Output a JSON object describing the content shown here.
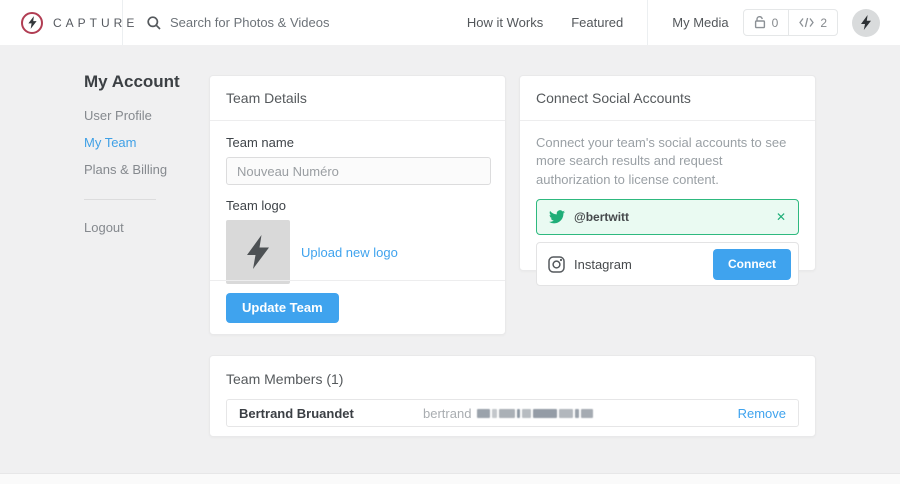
{
  "navbar": {
    "brand": "CAPTURE",
    "search_placeholder": "Search for Photos & Videos",
    "links": [
      {
        "label": "How it Works"
      },
      {
        "label": "Featured"
      }
    ],
    "my_media_label": "My Media",
    "locked_count": "0",
    "embed_count": "2"
  },
  "sidebar": {
    "title": "My Account",
    "items": [
      {
        "label": "User Profile"
      },
      {
        "label": "My Team"
      },
      {
        "label": "Plans & Billing"
      }
    ],
    "logout_label": "Logout"
  },
  "team_details": {
    "title": "Team Details",
    "team_name_label": "Team name",
    "team_name_value": "Nouveau Numéro",
    "team_logo_label": "Team logo",
    "upload_link_label": "Upload new logo",
    "update_button_label": "Update Team"
  },
  "social": {
    "title": "Connect Social Accounts",
    "description": "Connect your team's social accounts to see more search results and request authorization to license content.",
    "twitter": {
      "handle": "@bertwitt",
      "remove_glyph": "✕"
    },
    "instagram": {
      "label": "Instagram",
      "connect_button_label": "Connect"
    }
  },
  "team_members": {
    "title": "Team Members (1)",
    "members": [
      {
        "name": "Bertrand Bruandet",
        "email_visible_part": "bertrand",
        "remove_label": "Remove"
      }
    ]
  },
  "colors": {
    "accent_blue": "#3fa3ee",
    "success_green": "#2eb97f",
    "brand_red": "#b13d53",
    "page_background": "#f0f0f1"
  }
}
